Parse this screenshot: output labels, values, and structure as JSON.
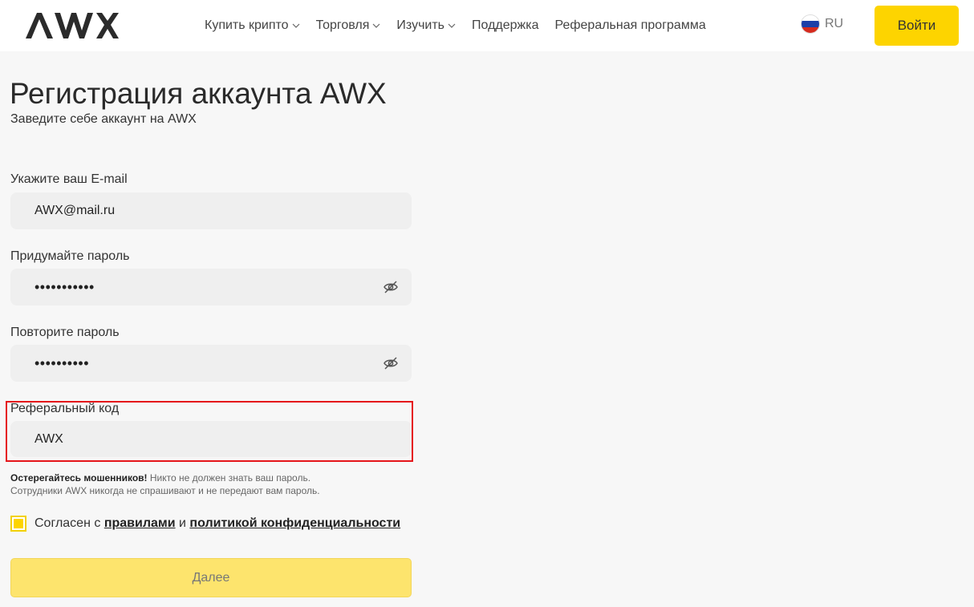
{
  "header": {
    "logo_text": "AWX",
    "nav": [
      {
        "label": "Купить крипто",
        "has_dropdown": true
      },
      {
        "label": "Торговля",
        "has_dropdown": true
      },
      {
        "label": "Изучить",
        "has_dropdown": true
      },
      {
        "label": "Поддержка",
        "has_dropdown": false
      },
      {
        "label": "Реферальная программа",
        "has_dropdown": false
      }
    ],
    "language": "RU",
    "login_label": "Войти"
  },
  "form": {
    "title": "Регистрация аккаунта AWX",
    "subtitle": "Заведите себе аккаунт на AWX",
    "email_label": "Укажите ваш E-mail",
    "email_value": "AWX@mail.ru",
    "password_label": "Придумайте пароль",
    "password_value": "•••••••••••",
    "repeat_label": "Повторите пароль",
    "repeat_value": "••••••••••",
    "referral_label": "Реферальный код",
    "referral_value": "AWX",
    "warning_bold": "Остерегайтесь мошенников!",
    "warning_text1": " Никто не должен знать ваш пароль.",
    "warning_text2": "Сотрудники AWX никогда не спрашивают и не передают вам пароль.",
    "agree_prefix": "Согласен с",
    "agree_rules": "правилами",
    "agree_and": "и",
    "agree_policy": "политикой конфиденциальности",
    "next_label": "Далее"
  },
  "colors": {
    "accent": "#fdd400",
    "highlight_border": "#e5141a",
    "field_bg": "#efefef"
  }
}
